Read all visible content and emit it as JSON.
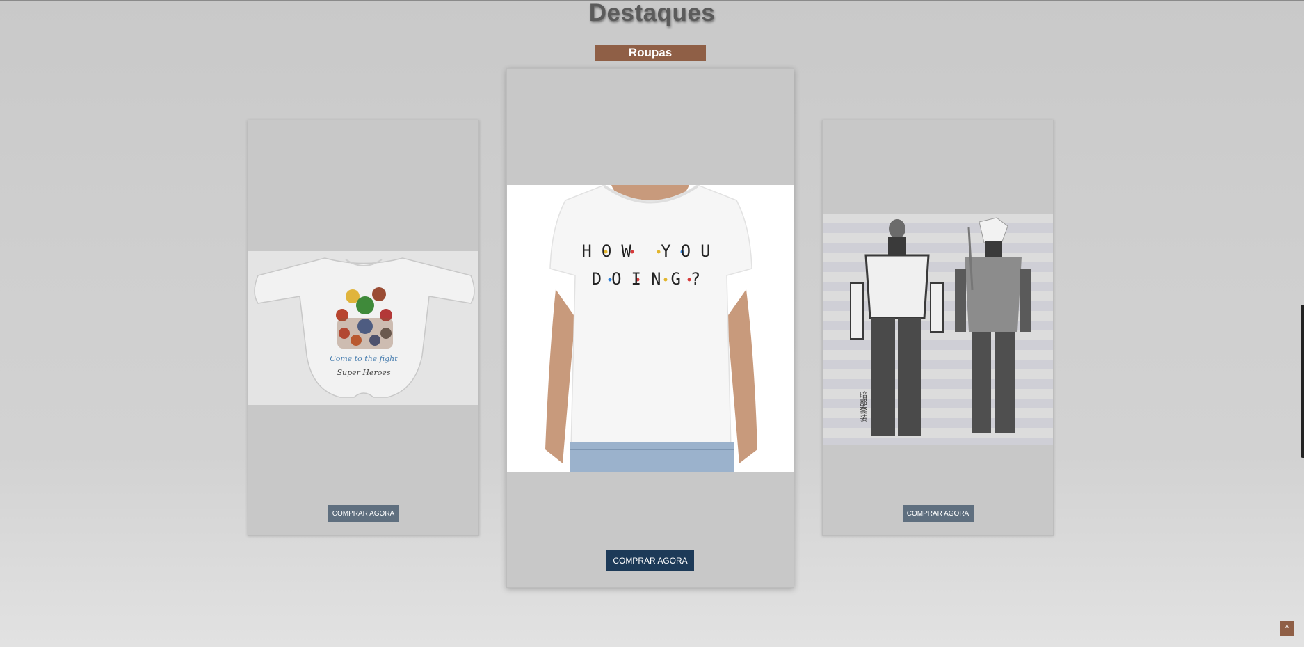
{
  "section": {
    "title": "Destaques",
    "category_tab": "Roupas"
  },
  "products": [
    {
      "image_icon": "baby-bodysuit-superheroes-image",
      "image_text": [
        "Come to the fight",
        "Super Heroes"
      ],
      "buy_label": "COMPRAR AGORA"
    },
    {
      "image_icon": "tshirt-how-you-doing-image",
      "image_text": [
        "HOW YOU",
        "DOING?"
      ],
      "buy_label": "COMPRAR AGORA"
    },
    {
      "image_icon": "ninja-costume-image",
      "image_text": [
        "暗部套装"
      ],
      "buy_label": "COMPRAR AGORA"
    }
  ],
  "back_to_top_label": "^",
  "colors": {
    "accent": "#8f5f46",
    "primary_button": "#1d3a58",
    "secondary_button": "#5f6f7f",
    "title": "#5b5b5b"
  }
}
